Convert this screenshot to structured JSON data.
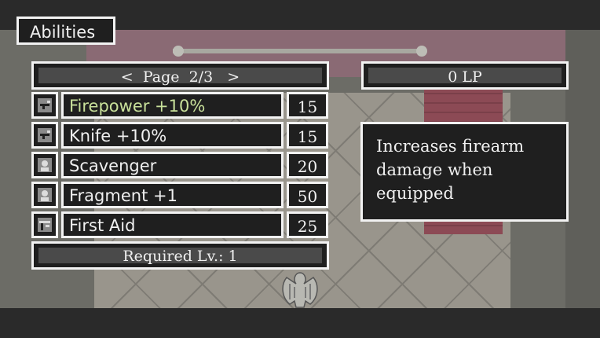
{
  "window_title": "Abilities",
  "pager": {
    "prev": "<",
    "label": "Page",
    "current": "2/3",
    "next": ">"
  },
  "lp_display": "0 LP",
  "abilities": [
    {
      "name": "Firepower +10%",
      "cost": "15",
      "icon": "gun-icon",
      "selected": true
    },
    {
      "name": "Knife +10%",
      "cost": "15",
      "icon": "knife-icon",
      "selected": false
    },
    {
      "name": "Scavenger",
      "cost": "20",
      "icon": "person-icon",
      "selected": false
    },
    {
      "name": "Fragment +1",
      "cost": "50",
      "icon": "person-icon",
      "selected": false
    },
    {
      "name": "First Aid",
      "cost": "25",
      "icon": "medkit-icon",
      "selected": false
    }
  ],
  "required_level": "Required Lv.: 1",
  "description": "Increases firearm damage when equipped",
  "colors": {
    "selected_text": "#c8e09a",
    "text": "#f0f0f0",
    "panel_border": "#f2f2f2",
    "panel_bg": "#1f1f1f"
  }
}
